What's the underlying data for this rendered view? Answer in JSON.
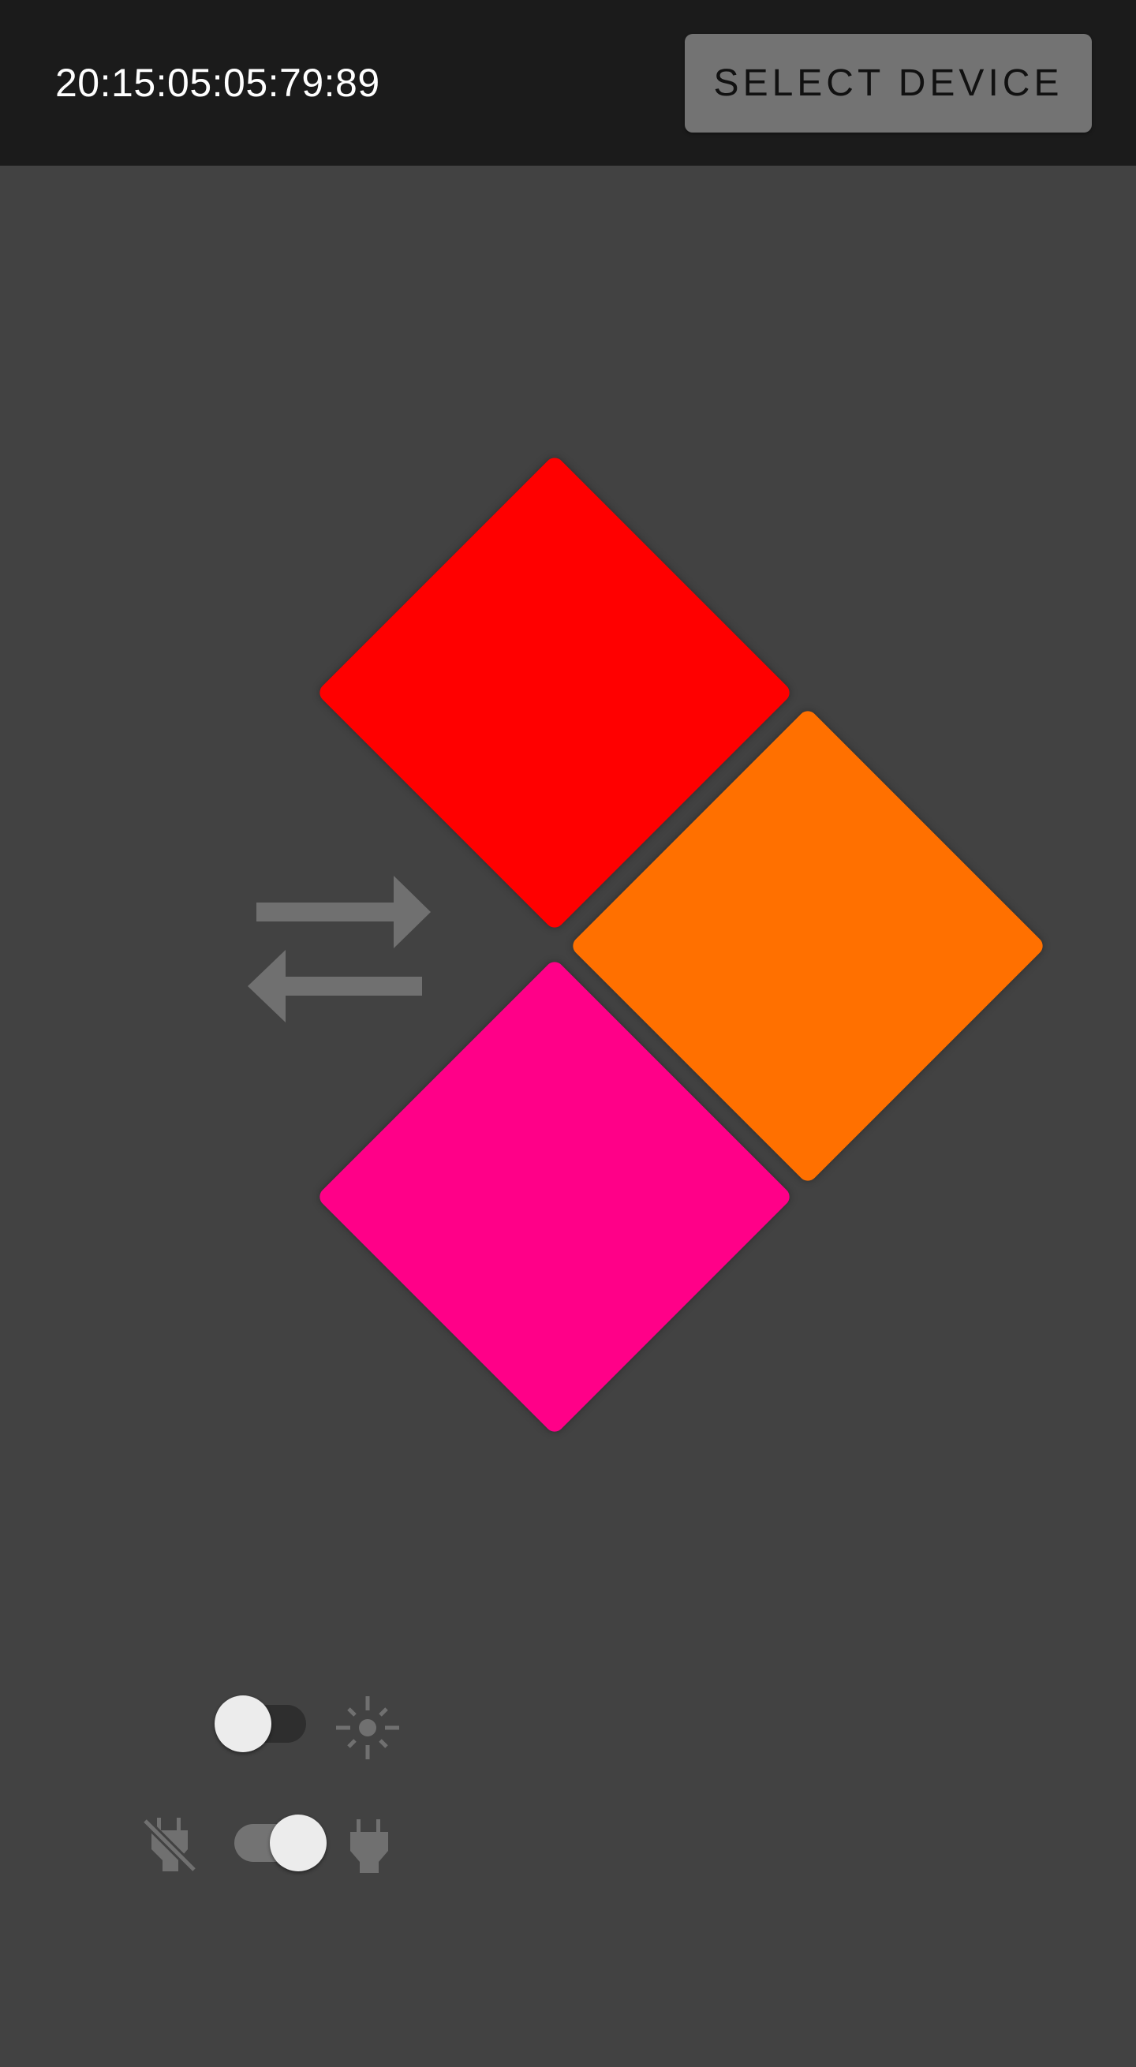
{
  "header": {
    "device_id": "20:15:05:05:79:89",
    "select_device_label": "SELECT DEVICE"
  },
  "tiles": [
    {
      "name": "tile-red",
      "color": "#ff0000"
    },
    {
      "name": "tile-orange",
      "color": "#ff7000"
    },
    {
      "name": "tile-pink",
      "color": "#ff0088"
    }
  ],
  "icons": {
    "swap": "swap-horiz-icon",
    "brightness": "brightness-icon",
    "power_off": "power-off-icon",
    "power_on": "power-icon"
  },
  "toggles": {
    "brightness": {
      "state": "off"
    },
    "power": {
      "state": "on"
    }
  },
  "colors": {
    "background": "#424242",
    "appbar": "#1b1b1b",
    "header_text": "#ffffff",
    "button_bg": "#737373",
    "button_text": "#111111",
    "icon": "#707070",
    "toggle_track_off": "#2e2e2e",
    "toggle_track_on": "#737373",
    "toggle_thumb": "#ececec"
  }
}
